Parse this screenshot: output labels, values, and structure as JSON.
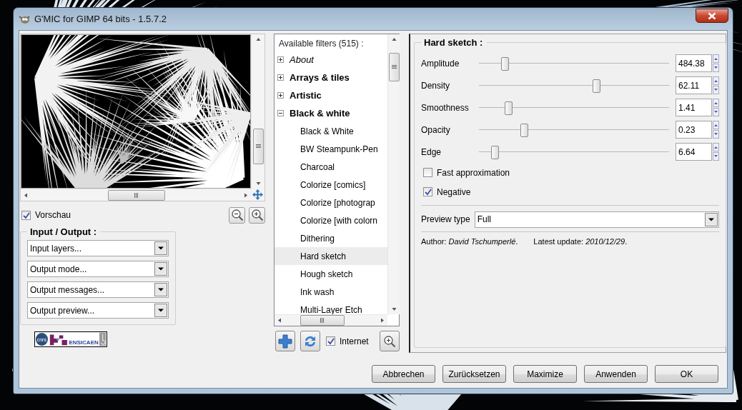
{
  "window": {
    "title": "G'MIC for GIMP 64 bits - 1.5.7.2"
  },
  "preview": {
    "kind": "picture",
    "toggle": {
      "label": "Vorschau",
      "checked": true
    }
  },
  "input_output": {
    "title": "Input / Output :",
    "dropdowns": [
      {
        "value": "Input layers..."
      },
      {
        "value": "Output mode..."
      },
      {
        "value": "Output messages..."
      },
      {
        "value": "Output preview..."
      }
    ]
  },
  "logo": {
    "texts": [
      "cnrs",
      "ENSICAEN"
    ]
  },
  "filters": {
    "header": "Available filters (515) :",
    "tree": [
      {
        "label": "About",
        "kind": "info",
        "expanded": false,
        "selected": false
      },
      {
        "label": "Arrays & tiles",
        "kind": "category",
        "expanded": false,
        "selected": false
      },
      {
        "label": "Artistic",
        "kind": "category",
        "expanded": false,
        "selected": false
      },
      {
        "label": "Black & white",
        "kind": "category",
        "expanded": true,
        "selected": false,
        "children": [
          {
            "label": "Black & White",
            "kind": "filter",
            "selected": false
          },
          {
            "label": "BW Steampunk-Pen",
            "kind": "filter",
            "selected": false
          },
          {
            "label": "Charcoal",
            "kind": "filter",
            "selected": false
          },
          {
            "label": "Colorize [comics]",
            "kind": "filter",
            "selected": false
          },
          {
            "label": "Colorize [photograp",
            "kind": "filter",
            "selected": false
          },
          {
            "label": "Colorize [with colorn",
            "kind": "filter",
            "selected": false
          },
          {
            "label": "Dithering",
            "kind": "filter",
            "selected": false
          },
          {
            "label": "Hard sketch",
            "kind": "filter",
            "selected": true
          },
          {
            "label": "Hough sketch",
            "kind": "filter",
            "selected": false
          },
          {
            "label": "Ink wash",
            "kind": "filter",
            "selected": false
          },
          {
            "label": "Multi-Layer Etch",
            "kind": "filter",
            "selected": false
          }
        ]
      }
    ],
    "internet": {
      "label": "Internet",
      "checked": true
    }
  },
  "settings": {
    "title": "Hard sketch :",
    "params": [
      {
        "kind": "slider",
        "label": "Amplitude",
        "level": 0.135,
        "value": "484.38"
      },
      {
        "kind": "slider",
        "label": "Density",
        "level": 0.617,
        "value": "62.11"
      },
      {
        "kind": "slider",
        "label": "Smoothness",
        "level": 0.154,
        "value": "1.41"
      },
      {
        "kind": "slider",
        "label": "Opacity",
        "level": 0.237,
        "value": "0.23"
      },
      {
        "kind": "slider",
        "label": "Edge",
        "level": 0.083,
        "value": "6.64"
      },
      {
        "kind": "checkbox",
        "label": "Fast approximation",
        "checked": false
      },
      {
        "kind": "checkbox",
        "label": "Negative",
        "checked": true
      }
    ],
    "preview_type": {
      "label": "Preview type",
      "value": "Full"
    },
    "author": "Author: *David Tschumperlé*.",
    "update": "Latest update: *2010/12/29*."
  },
  "buttons": [
    {
      "label": "Abbrechen"
    },
    {
      "label": "Zurücksetzen"
    },
    {
      "label": "Maximize"
    },
    {
      "label": "Anwenden"
    },
    {
      "label": "OK"
    }
  ]
}
